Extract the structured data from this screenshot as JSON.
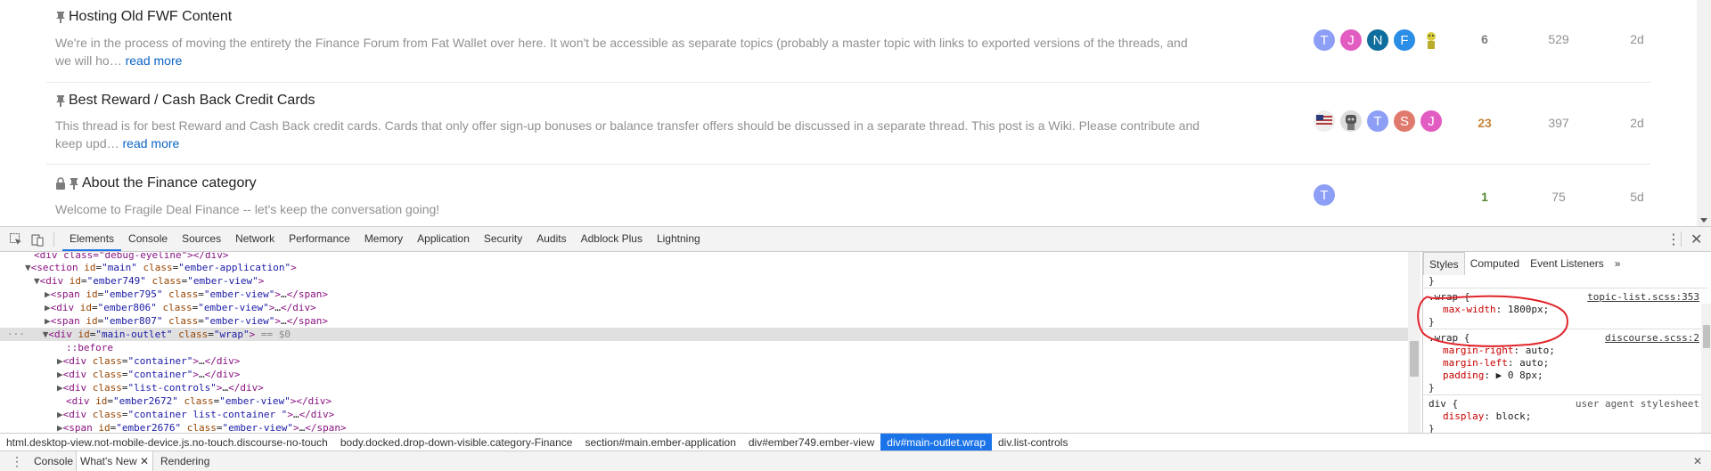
{
  "topics": [
    {
      "title": "Hosting Old FWF Content",
      "excerpt_line1": "We're in the process of moving the entirety the Finance Forum from Fat Wallet over here. It won't be accessible as separate topics (probably a master topic with links to exported versions of the threads, and",
      "excerpt_line2": "we will ho…",
      "read_more": "read more",
      "replies": "6",
      "views": "529",
      "activity": "2d",
      "posters": [
        {
          "letter": "T",
          "color": "#8c9ef5"
        },
        {
          "letter": "J",
          "color": "#e25cc1"
        },
        {
          "letter": "N",
          "color": "#0f6e9d"
        },
        {
          "letter": "F",
          "color": "#2a8de6"
        },
        {
          "letter": "",
          "color": "#d8cd3c"
        }
      ]
    },
    {
      "title": "Best Reward / Cash Back Credit Cards",
      "excerpt_line1": "This thread is for best Reward and Cash Back credit cards. Cards that only offer sign-up bonuses or balance transfer offers should be discussed in a separate thread. This post is a Wiki. Please contribute and",
      "excerpt_line2": "keep upd…",
      "read_more": "read more",
      "replies": "23",
      "views": "397",
      "activity": "2d",
      "posters": [
        {
          "letter": "",
          "color": "#b23b3b"
        },
        {
          "letter": "",
          "color": "#555555"
        },
        {
          "letter": "T",
          "color": "#8c9ef5"
        },
        {
          "letter": "S",
          "color": "#e07a6d"
        },
        {
          "letter": "J",
          "color": "#e25cc1"
        }
      ]
    },
    {
      "title": "About the Finance category",
      "excerpt_line1": "Welcome to Fragile Deal Finance -- let's keep the conversation going!",
      "replies": "1",
      "views": "75",
      "activity": "5d",
      "posters": [
        {
          "letter": "T",
          "color": "#8c9ef5"
        }
      ]
    }
  ],
  "devtools": {
    "tabs": [
      "Elements",
      "Console",
      "Sources",
      "Network",
      "Performance",
      "Memory",
      "Application",
      "Security",
      "Audits",
      "Adblock Plus",
      "Lightning"
    ],
    "styles_tabs": [
      "Styles",
      "Computed",
      "Event Listeners",
      "»"
    ],
    "dom": {
      "l0": "<div class=\"debug-eyeline\"></div>",
      "l1_tag": "section",
      "l1_id": "\"main\"",
      "l1_class": "\"ember-application\"",
      "l2_tag": "div",
      "l2_id": "\"ember749\"",
      "l2_class": "\"ember-view\"",
      "l3_tag": "span",
      "l3_id": "\"ember795\"",
      "l3_class": "\"ember-view\"",
      "l4_tag": "div",
      "l4_id": "\"ember806\"",
      "l4_class": "\"ember-view\"",
      "l5_tag": "span",
      "l5_id": "\"ember807\"",
      "l5_class": "\"ember-view\"",
      "l6_tag": "div",
      "l6_id": "\"main-outlet\"",
      "l6_class": "\"wrap\"",
      "l6_eq": "== $0",
      "l7": "::before",
      "l8_class": "\"container\"",
      "l9_class": "\"container\"",
      "l10_class": "\"list-controls\"",
      "l11_id": "\"ember2672\"",
      "l11_class": "\"ember-view\"",
      "l12_class": "\"container list-container \"",
      "l13_id": "\"ember2676\"",
      "l13_class": "\"ember-view\""
    },
    "styles": {
      "brace_top": "}",
      "r1_selector": ".wrap {",
      "r1_source": "topic-list.scss:353",
      "r1_prop": "max-width",
      "r1_val": "1800px;",
      "r2_selector": ".wrap {",
      "r2_source": "discourse.scss:2",
      "r2_p1": "margin-right",
      "r2_v1": "auto;",
      "r2_p2": "margin-left",
      "r2_v2": "auto;",
      "r2_p3": "padding",
      "r2_v3": "▶ 0 8px;",
      "r3_selector": "div {",
      "r3_source": "user agent stylesheet",
      "r3_prop": "display",
      "r3_val": "block;",
      "brace": "}"
    },
    "breadcrumbs": [
      "html.desktop-view.not-mobile-device.js.no-touch.discourse-no-touch",
      "body.docked.drop-down-visible.category-Finance",
      "section#main.ember-application",
      "div#ember749.ember-view",
      "div#main-outlet.wrap",
      "div.list-controls"
    ],
    "drawer_tabs": [
      "Console",
      "What's New",
      "Rendering"
    ]
  }
}
